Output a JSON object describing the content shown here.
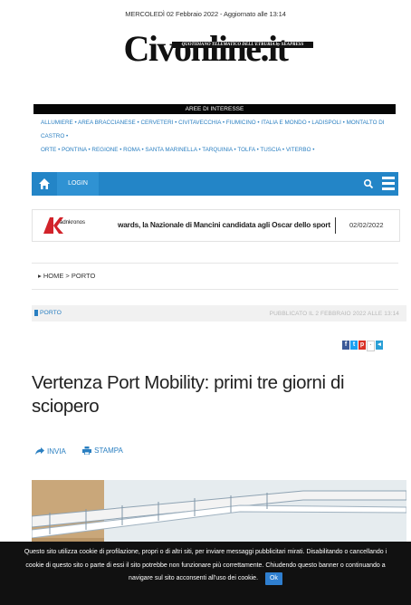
{
  "header": {
    "date_line": "MERCOLEDÌ 02 Febbraio 2022 - Aggiornato alle 13:14",
    "logo_main": "Civonline.it",
    "logo_tagline": "QUOTIDIANO TELEMATICO DELL'ETRURIA by SEAPRESS"
  },
  "areas": {
    "title": "AREE DI INTERESSE",
    "line1": "ALLUMIERE • AREA BRACCIANESE • CERVETERI • CIVITAVECCHIA • FIUMICINO • ITALIA E MONDO • LADISPOLI • MONTALTO DI CASTRO •",
    "line2": "ORTE • PONTINA • REGIONE • ROMA • SANTA MARINELLA • TARQUINIA • TOLFA • TUSCIA • VITERBO •"
  },
  "nav": {
    "login": "LOGIN",
    "icons": [
      "home-icon",
      "search-icon",
      "menu-icon"
    ]
  },
  "ticker": {
    "source_logo": "adnkronos",
    "headline": "wards, la Nazionale di Mancini candidata agli Oscar dello sport",
    "date": "02/02/2022"
  },
  "breadcrumb": {
    "text": "▸ HOME > PORTO"
  },
  "article": {
    "category": "PORTO",
    "published": "PUBBLICATO IL 2 FEBBRAIO 2022 ALLE 13:14",
    "title": "Vertenza Port Mobility: primi tre giorni di sciopero",
    "send_label": "INVIA",
    "print_label": "STAMPA"
  },
  "cookie_banner": {
    "line1": "Questo sito utilizza cookie di profilazione, propri o di altri siti, per inviare messaggi pubblicitari mirati. Disabilitando o cancellando i",
    "line2": "cookie di questo sito o parte di essi il sito potrebbe non funzionare più correttamente. Chiudendo questo banner o continuando a",
    "line3": "navigare sul sito acconsenti all'uso dei cookie.",
    "ok_label": "Ok"
  },
  "colors": {
    "accent_blue": "#2385c7",
    "link_blue": "#2a7fc1",
    "adnkronos_red": "#d2232a"
  }
}
